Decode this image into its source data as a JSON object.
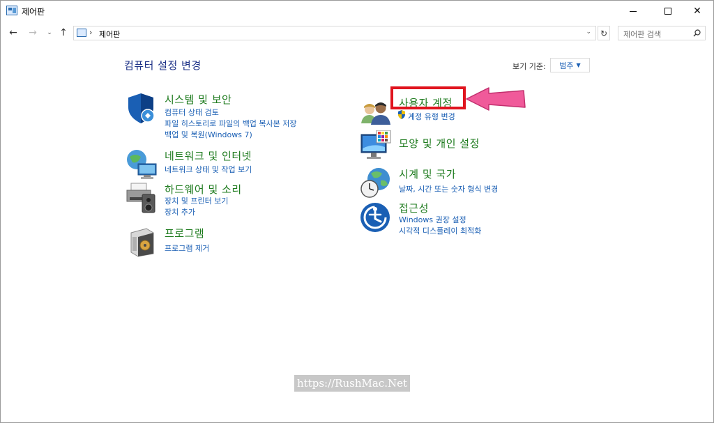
{
  "window": {
    "title": "제어판",
    "controls": {
      "minimize": "minimize-icon",
      "maximize": "maximize-icon",
      "close": "✕"
    }
  },
  "nav": {
    "back": "←",
    "forward": "→",
    "recent": "⌄",
    "up": "↑",
    "address_separator": "›",
    "address": "제어판",
    "address_dropdown": "⌄",
    "refresh": "↻",
    "search_placeholder": "제어판 검색"
  },
  "main": {
    "title": "컴퓨터 설정 변경",
    "view_by_label": "보기 기준:",
    "view_by_value": "범주",
    "view_by_caret": "▼"
  },
  "categories_left": [
    {
      "title": "시스템 및 보안",
      "icon": "shield-icon",
      "links": [
        "컴퓨터 상태 검토",
        "파일 히스토리로 파일의 백업 복사본 저장",
        "백업 및 복원(Windows 7)"
      ]
    },
    {
      "title": "네트워크 및 인터넷",
      "icon": "network-globe-icon",
      "links": [
        "네트워크 상태 및 작업 보기"
      ]
    },
    {
      "title": "하드웨어 및 소리",
      "icon": "printer-speaker-icon",
      "links": [
        "장치 및 프린터 보기",
        "장치 추가"
      ]
    },
    {
      "title": "프로그램",
      "icon": "program-box-icon",
      "links": [
        "프로그램 제거"
      ]
    }
  ],
  "categories_right": [
    {
      "title": "사용자 계정",
      "icon": "users-icon",
      "links": [
        "계정 유형 변경"
      ]
    },
    {
      "title": "모양 및 개인 설정",
      "icon": "display-palette-icon",
      "links": []
    },
    {
      "title": "시계 및 국가",
      "icon": "clock-globe-icon",
      "links": [
        "날짜, 시간 또는 숫자 형식 변경"
      ]
    },
    {
      "title": "접근성",
      "icon": "accessibility-icon",
      "links": [
        "Windows 권장 설정",
        "시각적 디스플레이 최적화"
      ]
    }
  ],
  "annotation": {
    "highlight_color": "#e0141e",
    "arrow_color": "#f05a9a"
  },
  "watermark": "https://RushMac.Net",
  "colors": {
    "title_blue": "#1e3287",
    "category_green": "#1e7b1e",
    "link_blue": "#1a5fb4"
  }
}
